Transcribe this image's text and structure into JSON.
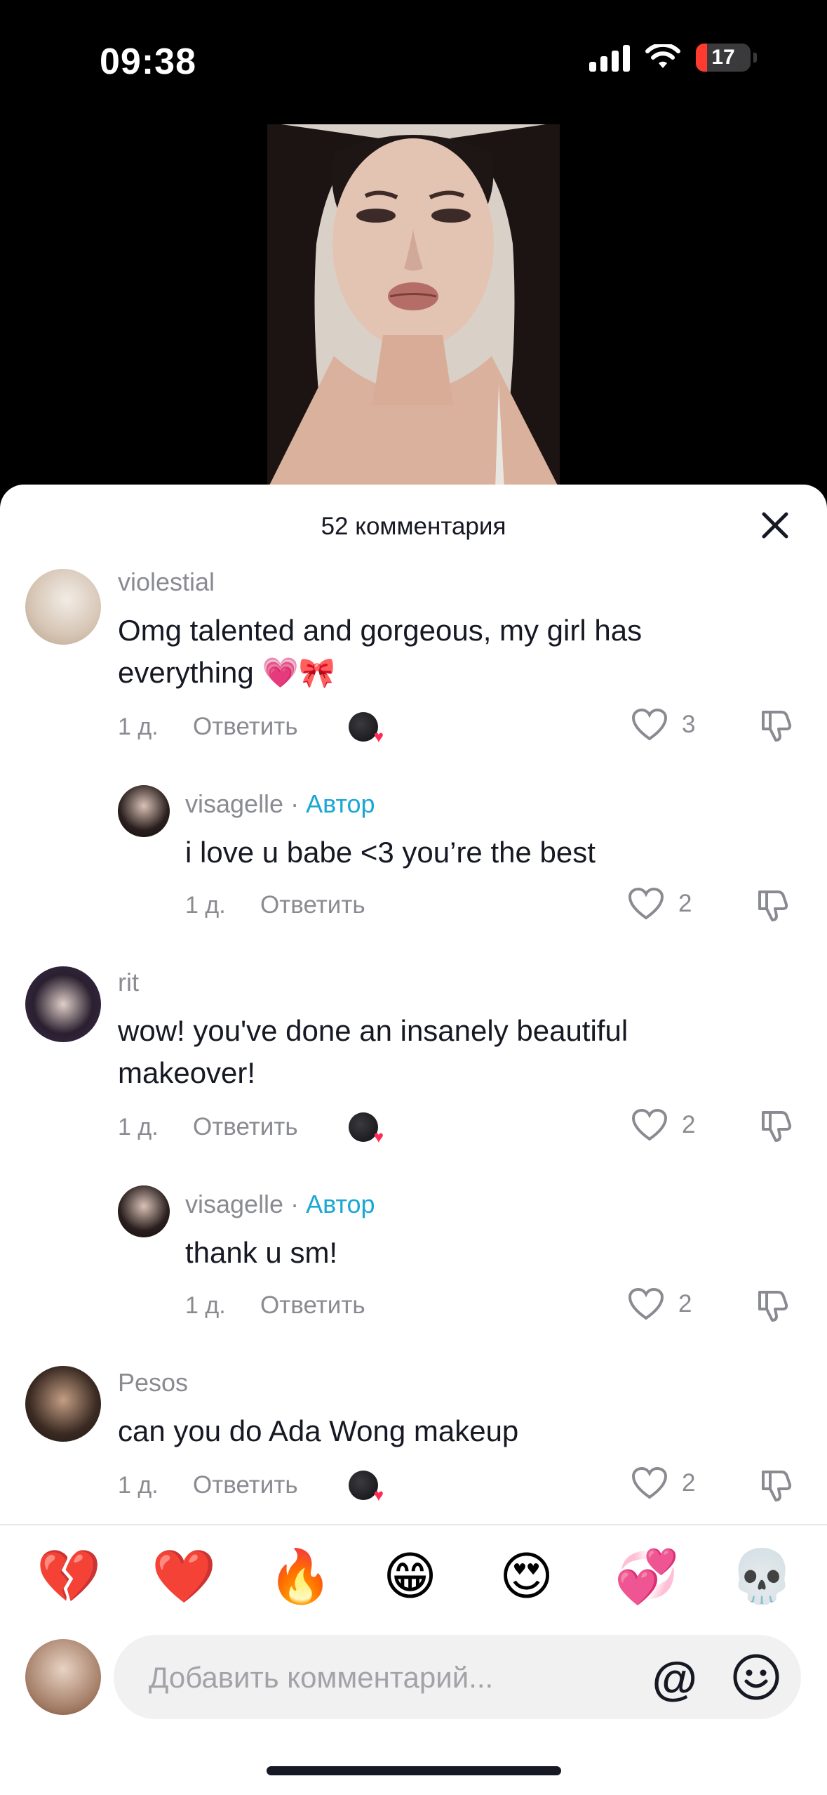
{
  "status_bar": {
    "time": "09:38",
    "battery": "17",
    "battery_color": "#ff3b30"
  },
  "sheet": {
    "title": "52 комментария"
  },
  "comments": [
    {
      "username": "violestial",
      "author_tag": "",
      "text": "Omg talented and gorgeous, my girl has everything 💗🎀",
      "time": "1 д.",
      "reply": "Ответить",
      "likes": "3",
      "creator_liked": true
    },
    {
      "username": "visagelle",
      "author_tag": "Автор",
      "text": "i love u babe <3 you’re the best",
      "time": "1 д.",
      "reply": "Ответить",
      "likes": "2",
      "creator_liked": false
    },
    {
      "username": "rit",
      "author_tag": "",
      "text": "wow! you've done an insanely beautiful makeover!",
      "time": "1 д.",
      "reply": "Ответить",
      "likes": "2",
      "creator_liked": true
    },
    {
      "username": "visagelle",
      "author_tag": "Автор",
      "text": "thank u sm!",
      "time": "1 д.",
      "reply": "Ответить",
      "likes": "2",
      "creator_liked": false
    },
    {
      "username": "Pesos",
      "author_tag": "",
      "text": "can you do Ada Wong makeup",
      "time": "1 д.",
      "reply": "Ответить",
      "likes": "2",
      "creator_liked": true
    }
  ],
  "quick_emojis": [
    "💔",
    "❤️",
    "🔥",
    "😁",
    "😍",
    "💞",
    "💀"
  ],
  "composer": {
    "placeholder": "Добавить комментарий...",
    "mention": "@"
  },
  "accent_color": "#fe2c55",
  "author_color": "#1ba7d4"
}
